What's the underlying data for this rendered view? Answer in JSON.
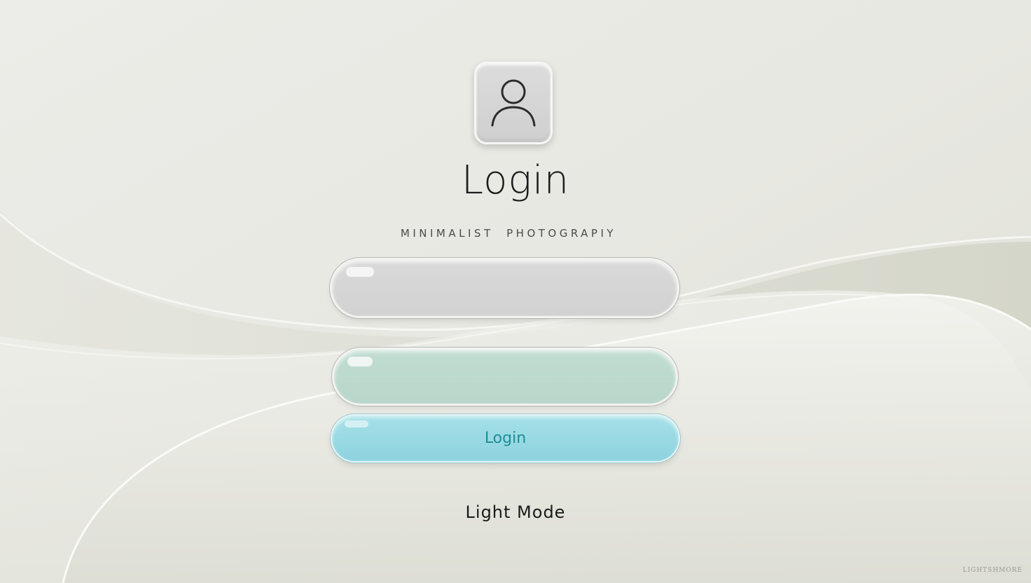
{
  "login": {
    "title": "Login",
    "subtitle": "MINIMALIST  PHOTOGRAPIY",
    "username": {
      "value": "",
      "placeholder": ""
    },
    "password": {
      "value": "",
      "placeholder": ""
    },
    "button_label": "Login",
    "mode_label": "Light Mode"
  },
  "avatar_icon": "user-icon",
  "watermark": "LIGHTSHMORE",
  "colors": {
    "background": "#e9e9e3",
    "username_field": "#d6d6d6",
    "password_field": "#bcd9cd",
    "button": "#98d9e3",
    "button_text": "#1e8e96",
    "text": "#1c1c1c"
  }
}
